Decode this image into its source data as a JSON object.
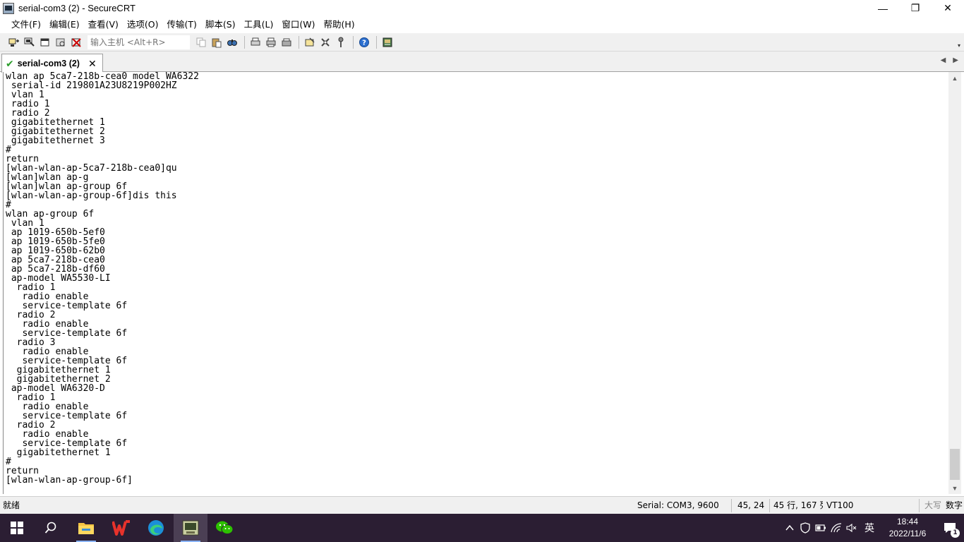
{
  "window": {
    "title": "serial-com3 (2) - SecureCRT",
    "minimize": "—",
    "restore": "❐",
    "close": "✕"
  },
  "menu": [
    "文件(F)",
    "编辑(E)",
    "查看(V)",
    "选项(O)",
    "传输(T)",
    "脚本(S)",
    "工具(L)",
    "窗口(W)",
    "帮助(H)"
  ],
  "toolbar": {
    "host_placeholder": "输入主机 <Alt+R>",
    "left_icons": [
      "connect-icon",
      "quick-connect-icon",
      "connect-tab-icon",
      "reconnect-icon",
      "disconnect-icon"
    ],
    "edit_icons": [
      "copy-icon",
      "paste-icon",
      "find-icon"
    ],
    "print_icons": [
      "print-setup-icon",
      "print-icon",
      "print-screen-icon"
    ],
    "options_icons": [
      "session-options-icon",
      "global-options-icon",
      "keymap-icon"
    ],
    "help_icon": "help-icon",
    "sftp_icon": "sftp-icon"
  },
  "tab": {
    "label": "serial-com3 (2)",
    "close": "✕",
    "status_color": "#2a9d2a"
  },
  "terminal": {
    "lines": [
      "wlan ap 5ca7-218b-cea0 model WA6322",
      " serial-id 219801A23U8219P002HZ",
      " vlan 1",
      " radio 1",
      " radio 2",
      " gigabitethernet 1",
      " gigabitethernet 2",
      " gigabitethernet 3",
      "#",
      "return",
      "[wlan-wlan-ap-5ca7-218b-cea0]qu",
      "[wlan]wlan ap-g",
      "[wlan]wlan ap-group 6f",
      "[wlan-wlan-ap-group-6f]dis this",
      "#",
      "wlan ap-group 6f",
      " vlan 1",
      " ap 1019-650b-5ef0",
      " ap 1019-650b-5fe0",
      " ap 1019-650b-62b0",
      " ap 5ca7-218b-cea0",
      " ap 5ca7-218b-df60",
      " ap-model WA5530-LI",
      "  radio 1",
      "   radio enable",
      "   service-template 6f",
      "  radio 2",
      "   radio enable",
      "   service-template 6f",
      "  radio 3",
      "   radio enable",
      "   service-template 6f",
      "  gigabitethernet 1",
      "  gigabitethernet 2",
      " ap-model WA6320-D",
      "  radio 1",
      "   radio enable",
      "   service-template 6f",
      "  radio 2",
      "   radio enable",
      "   service-template 6f",
      "  gigabitethernet 1",
      "#",
      "return",
      "[wlan-wlan-ap-group-6f]"
    ]
  },
  "status": {
    "ready": "就绪",
    "connection": "Serial: COM3, 9600",
    "cursor": "45,  24",
    "size": "45 行, 167 列",
    "emulation": "VT100",
    "caps": "大写",
    "num": "数字"
  },
  "taskbar": {
    "apps": [
      "start-icon",
      "search-icon",
      "file-explorer-icon",
      "wps-icon",
      "edge-icon",
      "securecrt-icon",
      "wechat-icon"
    ],
    "ime": "英",
    "time": "18:44",
    "date": "2022/11/6",
    "notification_count": "1"
  }
}
